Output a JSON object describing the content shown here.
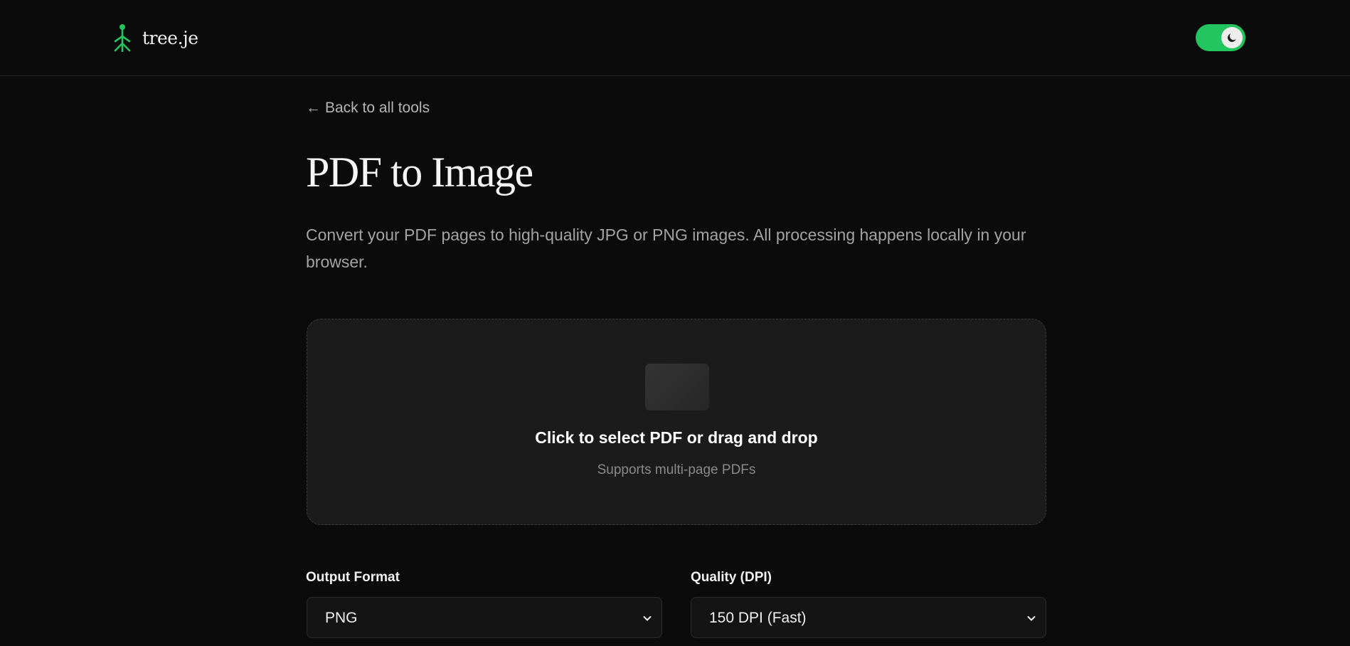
{
  "header": {
    "logo_text": "tree.je",
    "logo_icon": "stick-figure-tree-icon",
    "theme_toggle": {
      "state": "on",
      "icon": "moon-icon",
      "color": "#22c55e"
    }
  },
  "nav": {
    "back_arrow": "←",
    "back_label": "Back to all tools"
  },
  "page": {
    "title": "PDF to Image",
    "description": "Convert your PDF pages to high-quality JPG or PNG images. All processing happens locally in your browser."
  },
  "dropzone": {
    "title": "Click to select PDF or drag and drop",
    "subtitle": "Supports multi-page PDFs"
  },
  "options": {
    "format": {
      "label": "Output Format",
      "value": "PNG"
    },
    "quality": {
      "label": "Quality (DPI)",
      "value": "150 DPI (Fast)"
    }
  },
  "colors": {
    "accent": "#22c55e",
    "background": "#0b0b0b"
  }
}
